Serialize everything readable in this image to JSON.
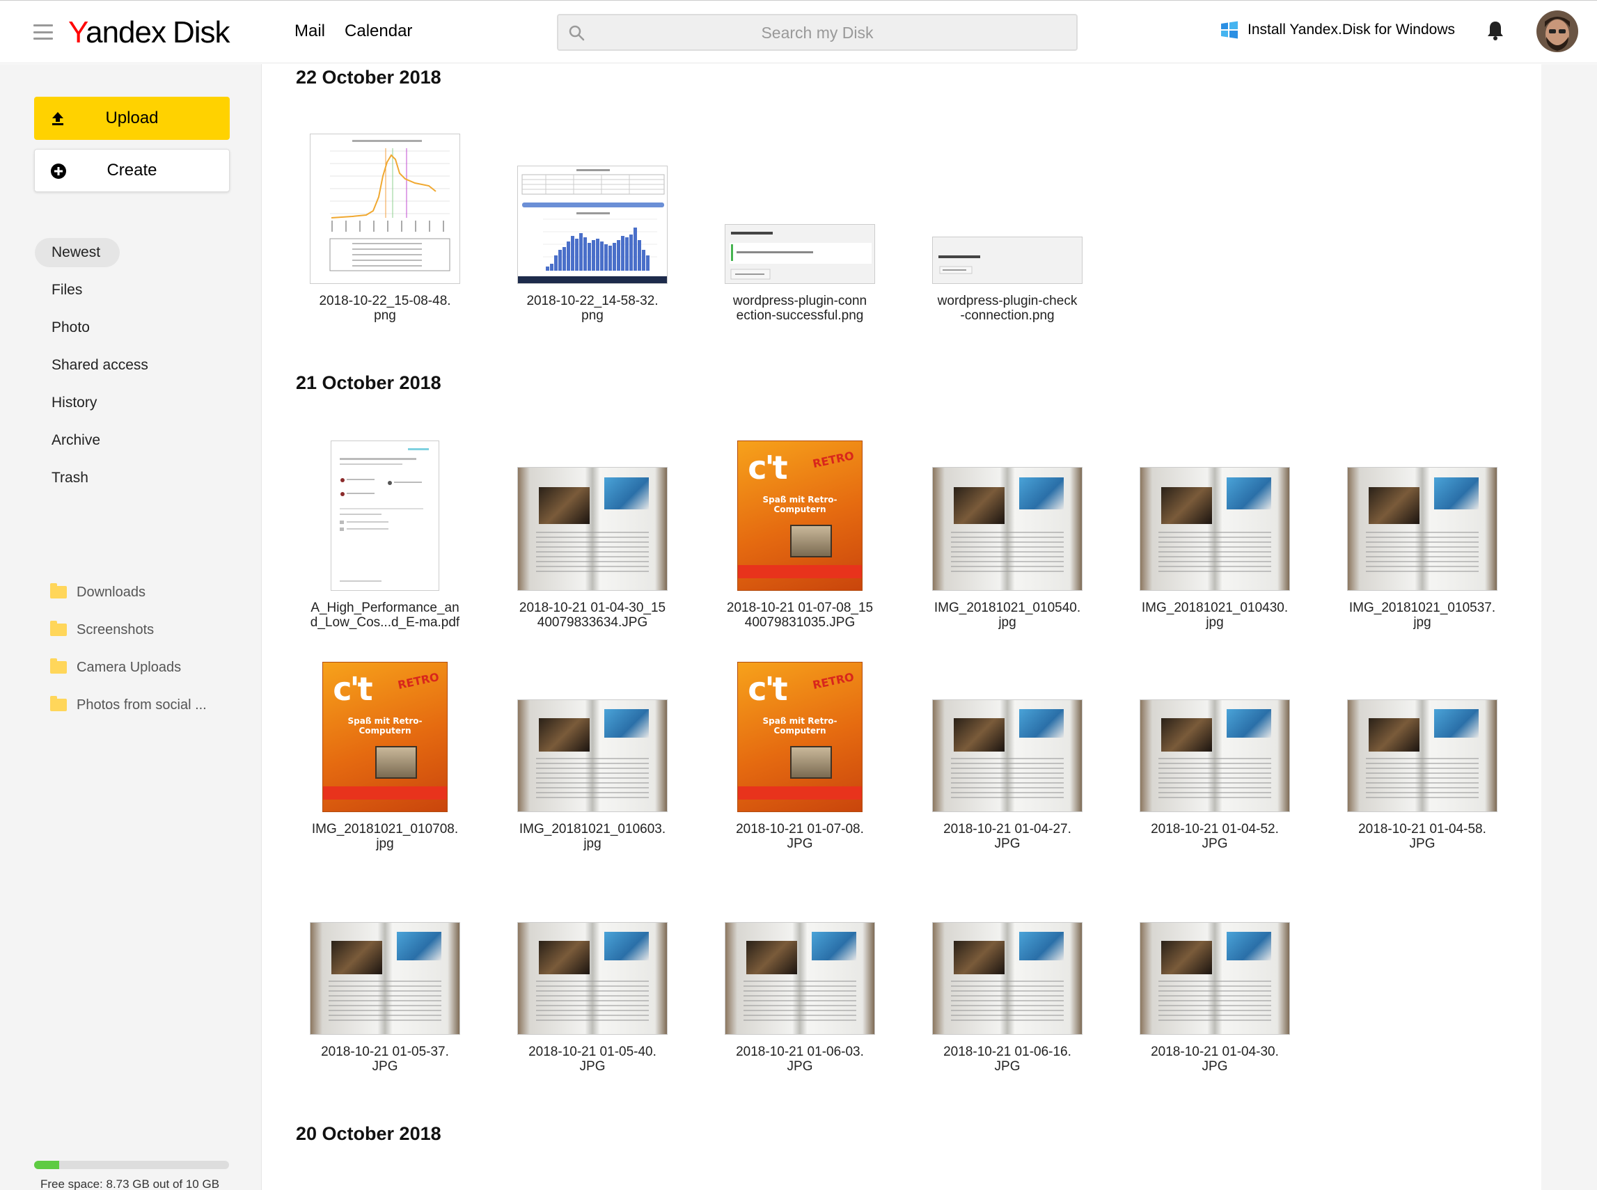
{
  "header": {
    "logo_y": "Y",
    "logo_rest": "andex",
    "logo_disk": "Disk",
    "nav": [
      "Mail",
      "Calendar"
    ],
    "search_placeholder": "Search my Disk",
    "install_label": "Install Yandex.Disk for Windows"
  },
  "sidebar": {
    "upload_label": "Upload",
    "create_label": "Create",
    "nav": [
      {
        "label": "Newest",
        "active": true
      },
      {
        "label": "Files",
        "active": false
      },
      {
        "label": "Photo",
        "active": false
      },
      {
        "label": "Shared access",
        "active": false
      },
      {
        "label": "History",
        "active": false
      },
      {
        "label": "Archive",
        "active": false
      },
      {
        "label": "Trash",
        "active": false
      }
    ],
    "folders": [
      "Downloads",
      "Screenshots",
      "Camera Uploads",
      "Photos from social ..."
    ],
    "storage_text": "Free space: 8.73 GB out of 10 GB",
    "storage_used_fraction": 0.127
  },
  "colors": {
    "accent_yellow": "#ffd200",
    "logo_red": "#ff0000",
    "storage_green": "#5ecb42"
  },
  "groups": [
    {
      "date": "22 October 2018",
      "files": [
        {
          "name": "2018-10-22_15-08-48.png",
          "line1": "2018-10-22_15-08-48.",
          "line2": "png",
          "thumb": "line-chart"
        },
        {
          "name": "2018-10-22_14-58-32.png",
          "line1": "2018-10-22_14-58-32.",
          "line2": "png",
          "thumb": "bar-chart"
        },
        {
          "name": "wordpress-plugin-connection-successful.png",
          "line1": "wordpress-plugin-conn",
          "line2": "ection-successful.png",
          "thumb": "dialog"
        },
        {
          "name": "wordpress-plugin-check-connection.png",
          "line1": "wordpress-plugin-check",
          "line2": "-connection.png",
          "thumb": "dialog-small"
        }
      ]
    },
    {
      "date": "21 October 2018",
      "files": [
        {
          "line1": "A_High_Performance_an",
          "line2": "d_Low_Cos...d_E-ma.pdf",
          "thumb": "pdf"
        },
        {
          "line1": "2018-10-21 01-04-30_15",
          "line2": "40079833634.JPG",
          "thumb": "spread"
        },
        {
          "line1": "2018-10-21 01-07-08_15",
          "line2": "40079831035.JPG",
          "thumb": "ct"
        },
        {
          "line1": "IMG_20181021_010540.",
          "line2": "jpg",
          "thumb": "spread"
        },
        {
          "line1": "IMG_20181021_010430.",
          "line2": "jpg",
          "thumb": "spread"
        },
        {
          "line1": "IMG_20181021_010537.",
          "line2": "jpg",
          "thumb": "spread"
        },
        {
          "line1": "IMG_20181021_010708.",
          "line2": "jpg",
          "thumb": "ct"
        },
        {
          "line1": "IMG_20181021_010603.",
          "line2": "jpg",
          "thumb": "spread"
        },
        {
          "line1": "2018-10-21 01-07-08.",
          "line2": "JPG",
          "thumb": "ct"
        },
        {
          "line1": "2018-10-21 01-04-27.",
          "line2": "JPG",
          "thumb": "spread"
        },
        {
          "line1": "2018-10-21 01-04-52.",
          "line2": "JPG",
          "thumb": "spread"
        },
        {
          "line1": "2018-10-21 01-04-58.",
          "line2": "JPG",
          "thumb": "spread"
        },
        {
          "line1": "2018-10-21 01-05-37.",
          "line2": "JPG",
          "thumb": "spread"
        },
        {
          "line1": "2018-10-21 01-05-40.",
          "line2": "JPG",
          "thumb": "spread"
        },
        {
          "line1": "2018-10-21 01-06-03.",
          "line2": "JPG",
          "thumb": "spread"
        },
        {
          "line1": "2018-10-21 01-06-16.",
          "line2": "JPG",
          "thumb": "spread"
        },
        {
          "line1": "2018-10-21 01-04-30.",
          "line2": "JPG",
          "thumb": "spread"
        }
      ]
    },
    {
      "date": "20 October 2018",
      "files": []
    }
  ]
}
